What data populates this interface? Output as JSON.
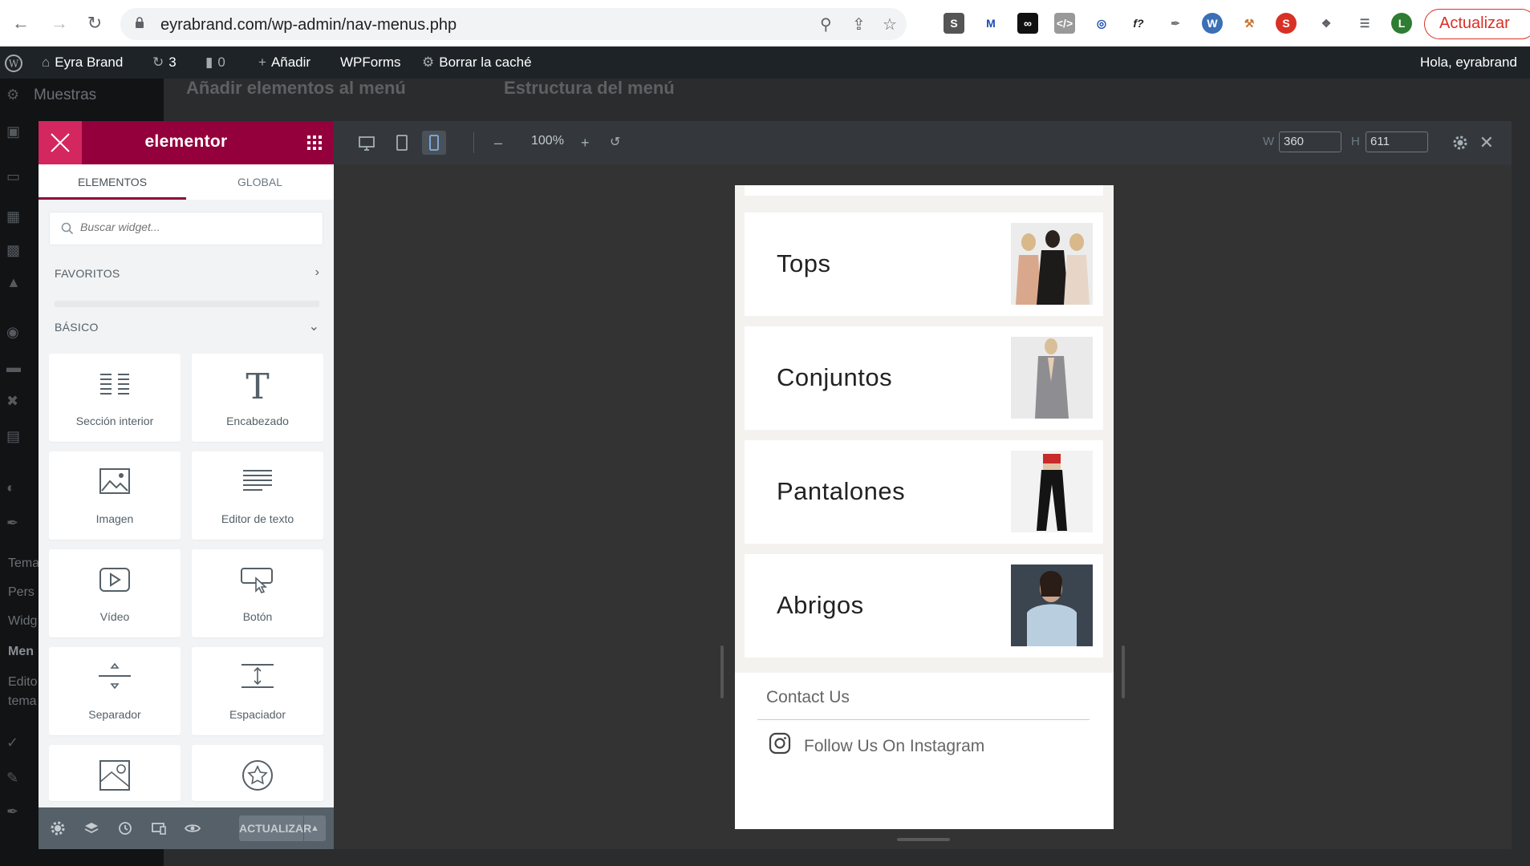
{
  "browser": {
    "url": "eyrabrand.com/wp-admin/nav-menus.php",
    "update_label": "Actualizar",
    "avatar_letter": "L"
  },
  "adminbar": {
    "site_name": "Eyra Brand",
    "updates_count": "3",
    "comments_count": "0",
    "add_label": "Añadir",
    "wpforms_label": "WPForms",
    "cache_label": "Borrar la caché",
    "greeting": "Hola, eyrabrand"
  },
  "wp_page": {
    "sidebar_top": "Muestras",
    "heading_left": "Añadir elementos al menú",
    "heading_right": "Estructura del menú",
    "sidebar_frag": [
      "Tema",
      "Pers",
      "Widg",
      "Men",
      "Edito",
      "tema"
    ]
  },
  "elementor": {
    "logo": "elementor",
    "tab_elements": "ELEMENTOS",
    "tab_global": "GLOBAL",
    "search_placeholder": "Buscar widget...",
    "cat_favorites": "FAVORITOS",
    "cat_basic": "BÁSICO",
    "widgets": [
      {
        "label": "Sección interior",
        "icon": "inner-section-icon"
      },
      {
        "label": "Encabezado",
        "icon": "heading-icon"
      },
      {
        "label": "Imagen",
        "icon": "image-icon"
      },
      {
        "label": "Editor de texto",
        "icon": "text-editor-icon"
      },
      {
        "label": "Vídeo",
        "icon": "video-icon"
      },
      {
        "label": "Botón",
        "icon": "button-icon"
      },
      {
        "label": "Separador",
        "icon": "divider-icon"
      },
      {
        "label": "Espaciador",
        "icon": "spacer-icon"
      },
      {
        "label": "",
        "icon": "google-maps-icon"
      },
      {
        "label": "",
        "icon": "star-icon"
      }
    ],
    "save_label": "ACTUALIZAR"
  },
  "responsive_bar": {
    "zoom": "100%",
    "w_label": "W",
    "w_value": "360",
    "h_label": "H",
    "h_value": "611"
  },
  "preview": {
    "menu_items": [
      "Tops",
      "Conjuntos",
      "Pantalones",
      "Abrigos"
    ],
    "contact": "Contact Us",
    "instagram": "Follow Us On Instagram"
  },
  "colors": {
    "elementor_brand": "#93003c",
    "elementor_close": "#d4265f"
  }
}
